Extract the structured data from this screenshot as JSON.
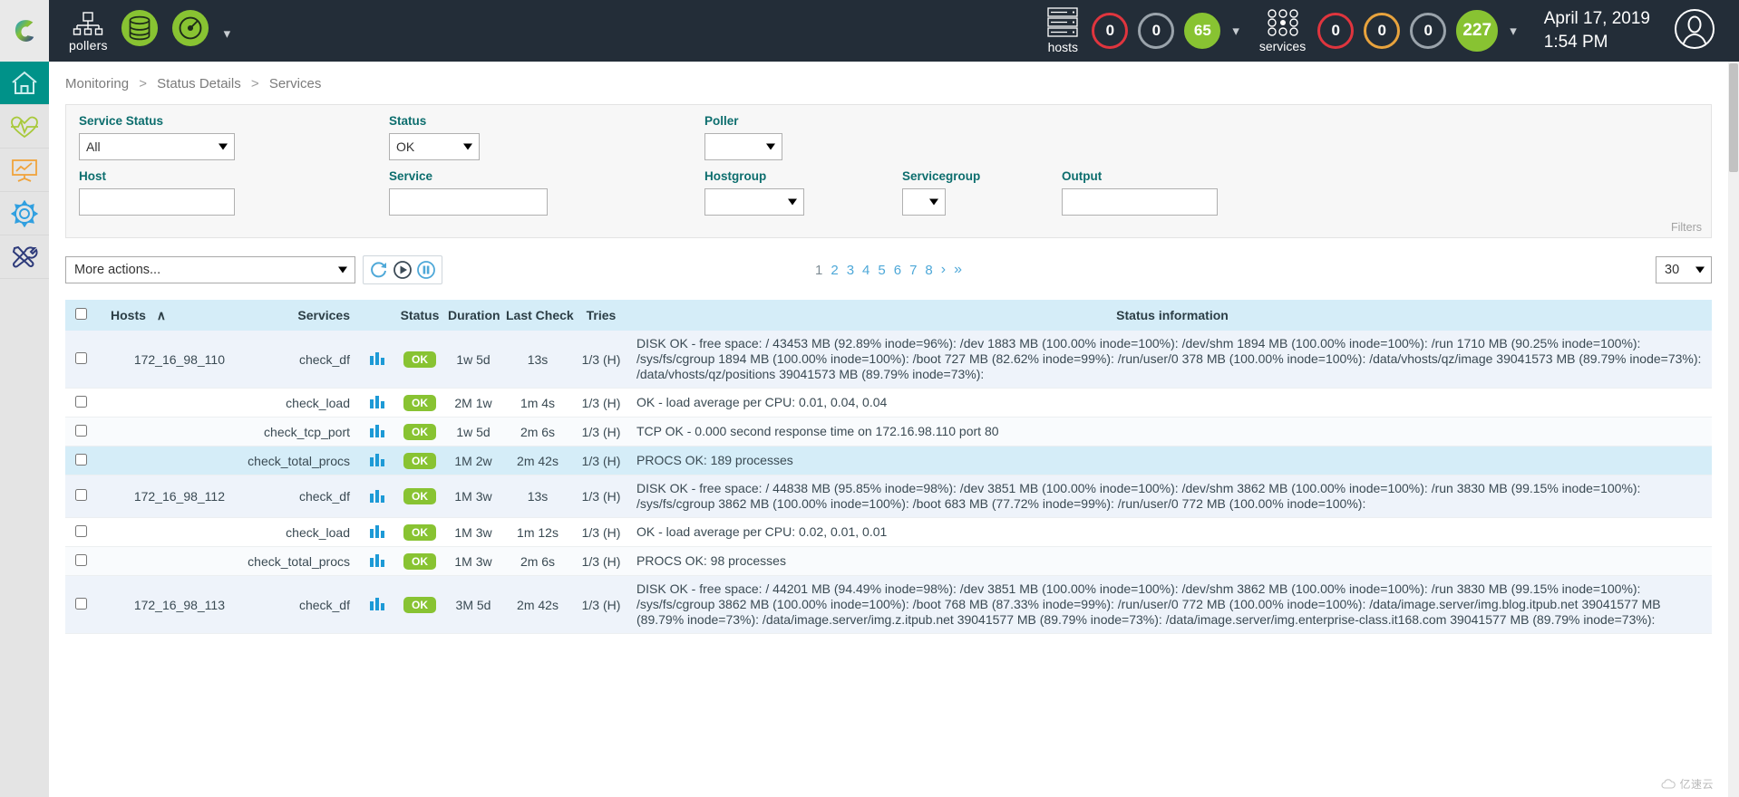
{
  "topbar": {
    "logo_name": "centreon-logo",
    "pollers_label": "pollers",
    "hosts_label": "hosts",
    "services_label": "services",
    "host_counts": [
      {
        "value": "0",
        "color": "#e0353e",
        "style": "red"
      },
      {
        "value": "0",
        "color": "#9aa3ab",
        "style": "grey"
      },
      {
        "value": "65",
        "color": "#88c332",
        "style": "green"
      }
    ],
    "service_counts": [
      {
        "value": "0",
        "color": "#e0353e",
        "style": "red"
      },
      {
        "value": "0",
        "color": "#e8a33d",
        "style": "orange"
      },
      {
        "value": "0",
        "color": "#9aa3ab",
        "style": "grey"
      },
      {
        "value": "227",
        "color": "#88c332",
        "style": "green"
      }
    ],
    "date": "April 17, 2019",
    "time": "1:54 PM"
  },
  "sidebar": {
    "items": [
      {
        "icon": "home-icon",
        "name": "sidebar-item-home",
        "active": true
      },
      {
        "icon": "heartbeat-icon",
        "name": "sidebar-item-monitoring",
        "active": false
      },
      {
        "icon": "chart-board-icon",
        "name": "sidebar-item-reporting",
        "active": false
      },
      {
        "icon": "gear-icon",
        "name": "sidebar-item-configuration",
        "active": false
      },
      {
        "icon": "tools-icon",
        "name": "sidebar-item-administration",
        "active": false
      }
    ]
  },
  "breadcrumb": {
    "items": [
      "Monitoring",
      "Status Details",
      "Services"
    ],
    "separator": ">"
  },
  "filters": {
    "tag": "Filters",
    "service_status": {
      "label": "Service Status",
      "value": "All"
    },
    "status": {
      "label": "Status",
      "value": "OK"
    },
    "poller": {
      "label": "Poller",
      "value": ""
    },
    "host": {
      "label": "Host",
      "value": "",
      "placeholder": ""
    },
    "service": {
      "label": "Service",
      "value": "",
      "placeholder": ""
    },
    "hostgroup": {
      "label": "Hostgroup",
      "value": ""
    },
    "servicegroup": {
      "label": "Servicegroup",
      "value": ""
    },
    "output": {
      "label": "Output",
      "value": "",
      "placeholder": ""
    }
  },
  "toolbar": {
    "more_actions": "More actions...",
    "refresh_icon": "refresh-icon",
    "play_icon": "play-icon",
    "pause_icon": "pause-icon",
    "per_page": "30",
    "pagination": {
      "pages": [
        "1",
        "2",
        "3",
        "4",
        "5",
        "6",
        "7",
        "8"
      ],
      "current": "1",
      "next": "›",
      "last": "»"
    }
  },
  "table": {
    "headers": {
      "hosts": "Hosts",
      "sort_indicator": "∧",
      "services": "Services",
      "status": "Status",
      "duration": "Duration",
      "last_check": "Last Check",
      "tries": "Tries",
      "status_information": "Status information"
    },
    "rows": [
      {
        "host": "172_16_98_110",
        "service": "check_df",
        "status": "OK",
        "duration": "1w 5d",
        "last_check": "13s",
        "tries": "1/3 (H)",
        "info": "DISK OK - free space: / 43453 MB (92.89% inode=96%): /dev 1883 MB (100.00% inode=100%): /dev/shm 1894 MB (100.00% inode=100%): /run 1710 MB (90.25% inode=100%): /sys/fs/cgroup 1894 MB (100.00% inode=100%): /boot 727 MB (82.62% inode=99%): /run/user/0 378 MB (100.00% inode=100%): /data/vhosts/qz/image 39041573 MB (89.79% inode=73%): /data/vhosts/qz/positions 39041573 MB (89.79% inode=73%):",
        "rowstyle": "r-light"
      },
      {
        "host": "",
        "service": "check_load",
        "status": "OK",
        "duration": "2M 1w",
        "last_check": "1m 4s",
        "tries": "1/3 (H)",
        "info": "OK - load average per CPU: 0.01, 0.04, 0.04",
        "rowstyle": "r-white"
      },
      {
        "host": "",
        "service": "check_tcp_port",
        "status": "OK",
        "duration": "1w 5d",
        "last_check": "2m 6s",
        "tries": "1/3 (H)",
        "info": "TCP OK - 0.000 second response time on 172.16.98.110 port 80",
        "rowstyle": "r-alt"
      },
      {
        "host": "",
        "service": "check_total_procs",
        "status": "OK",
        "duration": "1M 2w",
        "last_check": "2m 42s",
        "tries": "1/3 (H)",
        "info": "PROCS OK: 189 processes",
        "rowstyle": "r-sel"
      },
      {
        "host": "172_16_98_112",
        "service": "check_df",
        "status": "OK",
        "duration": "1M 3w",
        "last_check": "13s",
        "tries": "1/3 (H)",
        "info": "DISK OK - free space: / 44838 MB (95.85% inode=98%): /dev 3851 MB (100.00% inode=100%): /dev/shm 3862 MB (100.00% inode=100%): /run 3830 MB (99.15% inode=100%): /sys/fs/cgroup 3862 MB (100.00% inode=100%): /boot 683 MB (77.72% inode=99%): /run/user/0 772 MB (100.00% inode=100%):",
        "rowstyle": "r-light"
      },
      {
        "host": "",
        "service": "check_load",
        "status": "OK",
        "duration": "1M 3w",
        "last_check": "1m 12s",
        "tries": "1/3 (H)",
        "info": "OK - load average per CPU: 0.02, 0.01, 0.01",
        "rowstyle": "r-white"
      },
      {
        "host": "",
        "service": "check_total_procs",
        "status": "OK",
        "duration": "1M 3w",
        "last_check": "2m 6s",
        "tries": "1/3 (H)",
        "info": "PROCS OK: 98 processes",
        "rowstyle": "r-alt"
      },
      {
        "host": "172_16_98_113",
        "service": "check_df",
        "status": "OK",
        "duration": "3M 5d",
        "last_check": "2m 42s",
        "tries": "1/3 (H)",
        "info": "DISK OK - free space: / 44201 MB (94.49% inode=98%): /dev 3851 MB (100.00% inode=100%): /dev/shm 3862 MB (100.00% inode=100%): /run 3830 MB (99.15% inode=100%): /sys/fs/cgroup 3862 MB (100.00% inode=100%): /boot 768 MB (87.33% inode=99%): /run/user/0 772 MB (100.00% inode=100%): /data/image.server/img.blog.itpub.net 39041577 MB (89.79% inode=73%): /data/image.server/img.z.itpub.net 39041577 MB (89.79% inode=73%): /data/image.server/img.enterprise-class.it168.com 39041577 MB (89.79% inode=73%):",
        "rowstyle": "r-light"
      }
    ]
  },
  "colors": {
    "accent_teal": "#009289",
    "green": "#88c332",
    "red": "#e0353e",
    "orange": "#e8a33d",
    "header_bg": "#232d38",
    "table_header": "#d5edf8"
  },
  "watermark": "亿速云"
}
